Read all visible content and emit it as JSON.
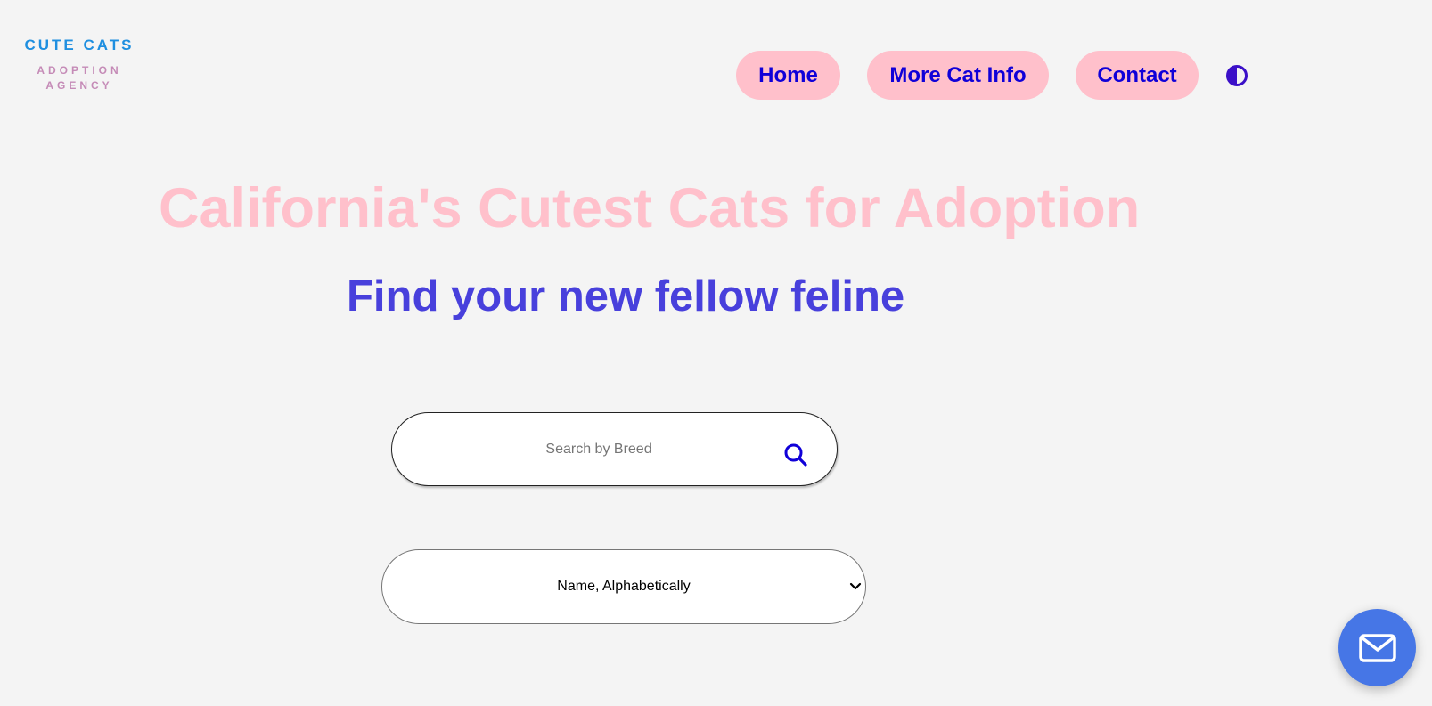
{
  "logo": {
    "title": "CUTE CATS",
    "subtitle_line1": "ADOPTION",
    "subtitle_line2": "AGENCY"
  },
  "nav": {
    "items": [
      {
        "label": "Home"
      },
      {
        "label": "More Cat Info"
      },
      {
        "label": "Contact"
      }
    ],
    "theme_toggle_icon": "contrast-icon"
  },
  "hero": {
    "title": "California's Cutest Cats for Adoption",
    "subtitle": "Find your new fellow feline"
  },
  "search": {
    "placeholder": "Search by Breed",
    "value": "",
    "icon": "search-icon"
  },
  "sort": {
    "selected": "Name, Alphabetically",
    "icon": "chevron-down-icon"
  },
  "fab": {
    "icon": "envelope-icon"
  },
  "colors": {
    "background": "#f4f4f4",
    "logo_title": "#1f8fe0",
    "logo_sub": "#c58bb7",
    "nav_bg": "#ffc0cb",
    "nav_text": "#1000d8",
    "hero_title": "#ffc0cb",
    "hero_subtitle": "#4840dc",
    "fab_bg": "#4676e6"
  }
}
